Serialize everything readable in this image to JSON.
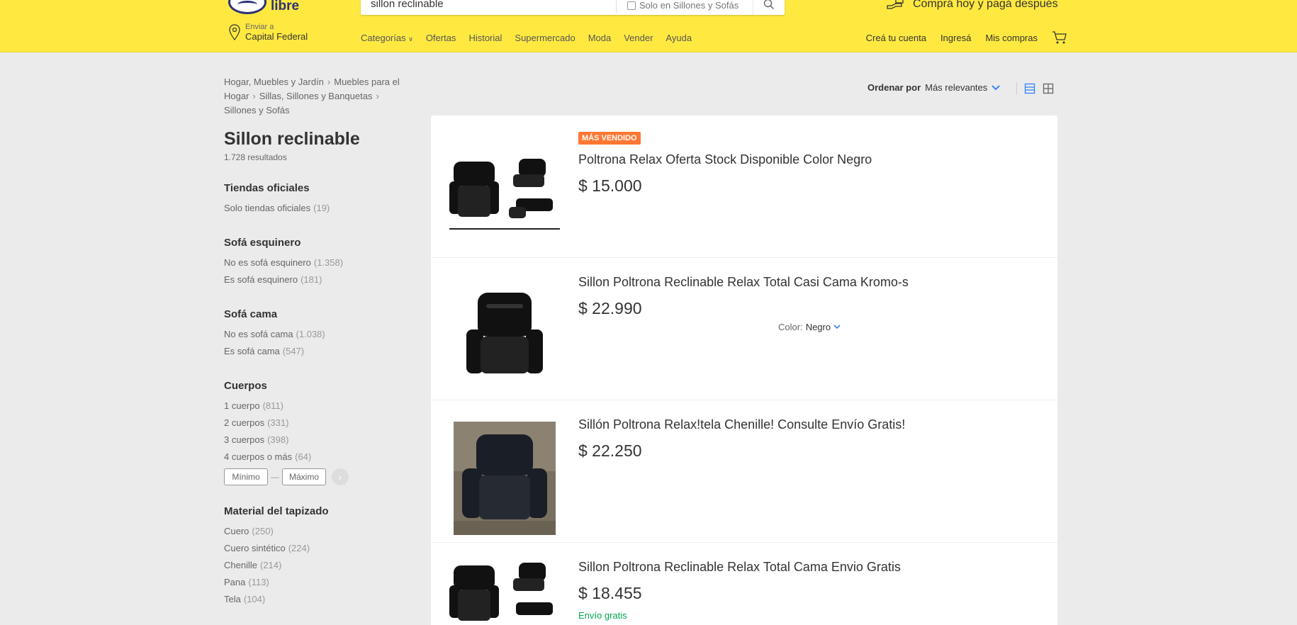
{
  "header": {
    "logo_text": "libre",
    "search": {
      "value": "sillon reclinable",
      "filter_label": "Solo en Sillones y Sofás"
    },
    "promo_text": "Comprá hoy y pagá después",
    "shipping": {
      "label": "Enviar a",
      "location": "Capital Federal"
    },
    "nav": [
      "Categorías",
      "Ofertas",
      "Historial",
      "Supermercado",
      "Moda",
      "Vender",
      "Ayuda"
    ],
    "user_nav": {
      "create_account": "Creá tu cuenta",
      "login": "Ingresá",
      "purchases": "Mis compras"
    },
    "brand_color": "#ffe941"
  },
  "sidebar": {
    "breadcrumb": [
      "Hogar, Muebles y Jardín",
      "Muebles para el Hogar",
      "Sillas, Sillones y Banquetas",
      "Sillones y Sofás"
    ],
    "title": "Sillon reclinable",
    "results": "1.728 resultados",
    "filters": [
      {
        "title": "Tiendas oficiales",
        "items": [
          {
            "label": "Solo tiendas oficiales",
            "count": "(19)"
          }
        ]
      },
      {
        "title": "Sofá esquinero",
        "items": [
          {
            "label": "No es sofá esquinero",
            "count": "(1.358)"
          },
          {
            "label": "Es sofá esquinero",
            "count": "(181)"
          }
        ]
      },
      {
        "title": "Sofá cama",
        "items": [
          {
            "label": "No es sofá cama",
            "count": "(1.038)"
          },
          {
            "label": "Es sofá cama",
            "count": "(547)"
          }
        ]
      },
      {
        "title": "Cuerpos",
        "items": [
          {
            "label": "1 cuerpo",
            "count": "(811)"
          },
          {
            "label": "2 cuerpos",
            "count": "(331)"
          },
          {
            "label": "3 cuerpos",
            "count": "(398)"
          },
          {
            "label": "4 cuerpos o más",
            "count": "(64)"
          }
        ]
      },
      {
        "title": "Material del tapizado",
        "items": [
          {
            "label": "Cuero",
            "count": "(250)"
          },
          {
            "label": "Cuero sintético",
            "count": "(224)"
          },
          {
            "label": "Chenille",
            "count": "(214)"
          },
          {
            "label": "Pana",
            "count": "(113)"
          },
          {
            "label": "Tela",
            "count": "(104)"
          }
        ]
      }
    ],
    "range": {
      "min_placeholder": "Mínimo",
      "max_placeholder": "Máximo",
      "dash": "—"
    }
  },
  "sort": {
    "label": "Ordenar por",
    "value": "Más relevantes"
  },
  "results": [
    {
      "badge": "MÁS VENDIDO",
      "title": "Poltrona Relax Oferta Stock Disponible Color Negro",
      "price": "$ 15.000"
    },
    {
      "title": "Sillon Poltrona Reclinable Relax Total Casi Cama Kromo-s",
      "price": "$ 22.990",
      "color_label": "Color:",
      "color_value": "Negro"
    },
    {
      "title": "Sillón Poltrona Relax!tela Chenille! Consulte Envío Gratis!",
      "price": "$ 22.250"
    },
    {
      "title": "Sillon Poltrona Reclinable Relax Total Cama Envio Gratis",
      "price": "$ 18.455",
      "shipping": "Envío gratis"
    }
  ]
}
